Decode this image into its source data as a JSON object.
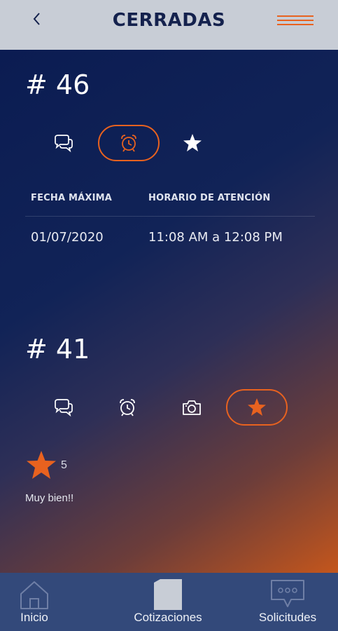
{
  "header": {
    "title": "CERRADAS",
    "back_icon": "chevron-left-icon",
    "menu_icon": "menu-icon",
    "accent_color": "#e8621f"
  },
  "orders": [
    {
      "number": "# 46",
      "active_tab": "alarm",
      "tabs": [
        "comments-icon",
        "alarm-clock-icon",
        "star-icon"
      ],
      "table": {
        "headers": [
          "FECHA MÁXIMA",
          "HORARIO DE ATENCIÓN"
        ],
        "values": [
          "01/07/2020",
          "11:08 AM a 12:08 PM"
        ]
      }
    },
    {
      "number": "# 41",
      "active_tab": "star",
      "tabs": [
        "comments-icon",
        "alarm-clock-icon",
        "camera-icon",
        "star-icon"
      ],
      "rating": {
        "value": "5",
        "comment": "Muy bien!!"
      }
    }
  ],
  "bottom_nav": {
    "items": [
      {
        "label": "Inicio",
        "icon": "home-icon"
      },
      {
        "label": "Cotizaciones",
        "icon": "document-icon"
      },
      {
        "label": "Solicitudes",
        "icon": "chat-bubble-icon"
      }
    ]
  }
}
